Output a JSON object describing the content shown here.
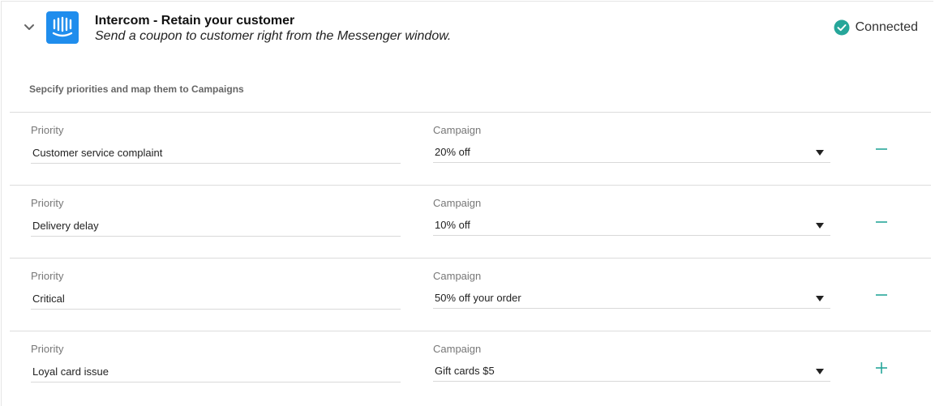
{
  "integration": {
    "title": "Intercom - Retain your customer",
    "subtitle": "Send a coupon to customer right from the Messenger window.",
    "logo_icon": "intercom-logo-icon",
    "status": {
      "label": "Connected",
      "icon": "check-circle-icon",
      "color": "#26a69a"
    }
  },
  "section_label": "Sepcify priorities and map them to Campaigns",
  "accent_color": "#26a69a",
  "rows": [
    {
      "priority_label": "Priority",
      "priority_value": "Customer service complaint",
      "campaign_label": "Campaign",
      "campaign_value": "20% off",
      "action": "remove"
    },
    {
      "priority_label": "Priority",
      "priority_value": "Delivery delay",
      "campaign_label": "Campaign",
      "campaign_value": "10% off",
      "action": "remove"
    },
    {
      "priority_label": "Priority",
      "priority_value": "Critical",
      "campaign_label": "Campaign",
      "campaign_value": "50% off your order",
      "action": "remove"
    },
    {
      "priority_label": "Priority",
      "priority_value": "Loyal card issue",
      "campaign_label": "Campaign",
      "campaign_value": "Gift cards $5",
      "action": "add"
    }
  ]
}
